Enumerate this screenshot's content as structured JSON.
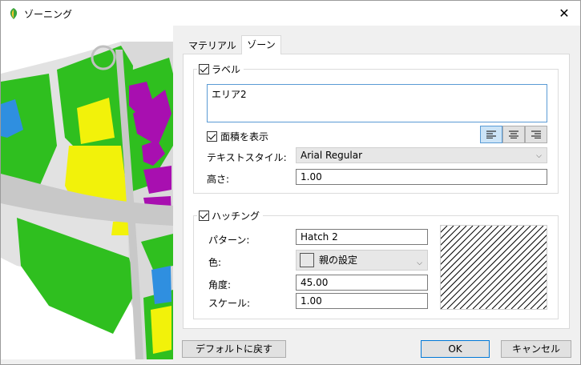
{
  "window": {
    "title": "ゾーニング",
    "close_glyph": "✕"
  },
  "tabs": [
    {
      "label": "マテリアル"
    },
    {
      "label": "ゾーン"
    }
  ],
  "label_group": {
    "checkbox_label": "ラベル",
    "checked": true,
    "text_value": "エリア2",
    "show_area_label": "面積を表示",
    "show_area_checked": true,
    "text_style_label": "テキストスタイル:",
    "text_style_value": "Arial Regular",
    "height_label": "高さ:",
    "height_value": "1.00",
    "alignment": [
      "align-left",
      "align-center",
      "align-right"
    ],
    "active_alignment": "align-left"
  },
  "hatch_group": {
    "checkbox_label": "ハッチング",
    "checked": true,
    "pattern_label": "パターン:",
    "pattern_value": "Hatch 2",
    "color_label": "色:",
    "color_value": "親の設定",
    "angle_label": "角度:",
    "angle_value": "45.00",
    "scale_label": "スケール:",
    "scale_value": "1.00"
  },
  "buttons": {
    "reset": "デフォルトに戻す",
    "ok": "OK",
    "cancel": "キャンセル"
  },
  "colors": {
    "accent": "#0078d7",
    "map_green": "#2fbf1f",
    "map_purple": "#a80fb0",
    "map_yellow": "#f2f20a",
    "map_blue": "#2f8fe0",
    "map_road": "#c8c8c8"
  }
}
